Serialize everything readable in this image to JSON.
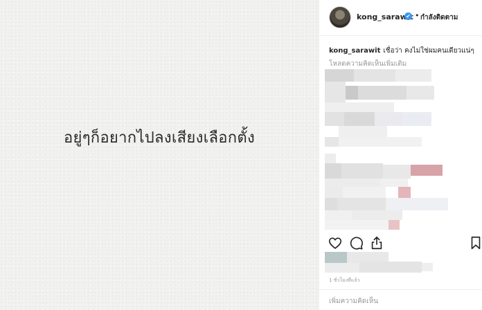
{
  "post": {
    "image_text": "อยู่ๆก็อยากไปลงเสียงเลือกตั้ง"
  },
  "header": {
    "username": "kong_sarawit",
    "verified_mark": "✔",
    "separator": "•",
    "follow_status": "กำลังติดตาม"
  },
  "caption": {
    "username": "kong_sarawit",
    "text": "เชื่อว่า คงไม่ใช่ผมคนเดียวแน่ๆ"
  },
  "comments": {
    "load_more": "โหลดความคิดเห็นเพิ่มเติม"
  },
  "actions": {
    "like_icon": "heart-icon",
    "comment_icon": "comment-icon",
    "share_icon": "share-icon",
    "save_icon": "bookmark-icon"
  },
  "timestamp": "1 ชั่วโมงที่แล้ว",
  "comment_box": {
    "placeholder": "เพิ่มความคิดเห็น"
  },
  "colors": {
    "verified": "#3897f0",
    "blur_pink": "#d7a2a8"
  }
}
